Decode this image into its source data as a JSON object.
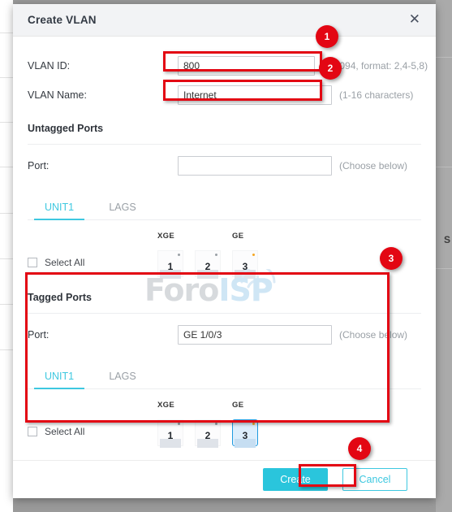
{
  "dialog": {
    "title": "Create VLAN",
    "close_icon": "close-icon"
  },
  "fields": [
    {
      "label": "VLAN ID:",
      "value": "800",
      "placeholder": "",
      "hint": "(2-4094, format: 2,4-5,8)"
    },
    {
      "label": "VLAN Name:",
      "value": "Internet",
      "placeholder": "",
      "hint": "(1-16 characters)"
    }
  ],
  "untagged": {
    "section_title": "Untagged Ports",
    "port_label": "Port:",
    "port_value": "",
    "port_placeholder": "",
    "port_hint": "(Choose below)",
    "tabs": [
      {
        "label": "UNIT1",
        "active": true
      },
      {
        "label": "LAGS",
        "active": false
      }
    ],
    "select_all_label": "Select All",
    "groups": [
      {
        "label": "XGE"
      },
      {
        "label": "GE"
      }
    ],
    "ports": [
      {
        "num": "1",
        "group": "XGE",
        "selected": false,
        "led": "grey"
      },
      {
        "num": "2",
        "group": "XGE",
        "selected": false,
        "led": "grey"
      },
      {
        "num": "3",
        "group": "GE",
        "selected": false,
        "led": "amber"
      }
    ]
  },
  "tagged": {
    "section_title": "Tagged Ports",
    "port_label": "Port:",
    "port_value": "GE 1/0/3",
    "port_placeholder": "",
    "port_hint": "(Choose below)",
    "tabs": [
      {
        "label": "UNIT1",
        "active": true
      },
      {
        "label": "LAGS",
        "active": false
      }
    ],
    "select_all_label": "Select All",
    "groups": [
      {
        "label": "XGE"
      },
      {
        "label": "GE"
      }
    ],
    "ports": [
      {
        "num": "1",
        "group": "XGE",
        "selected": false,
        "led": "grey"
      },
      {
        "num": "2",
        "group": "XGE",
        "selected": false,
        "led": "grey"
      },
      {
        "num": "3",
        "group": "GE",
        "selected": true,
        "led": "amber"
      }
    ]
  },
  "footer": {
    "create_label": "Create",
    "cancel_label": "Cancel"
  },
  "annotations": {
    "badges": [
      "1",
      "2",
      "3",
      "4"
    ],
    "color": "#e30613"
  },
  "watermark": {
    "text_a": "Foro",
    "text_b": "ISP"
  },
  "background": {
    "right_letter": "S"
  },
  "colors": {
    "accent": "#3ec8e0",
    "primary_button": "#2ac5dc",
    "annotation_red": "#e30613",
    "selected_port_border": "#1f9ae0"
  }
}
